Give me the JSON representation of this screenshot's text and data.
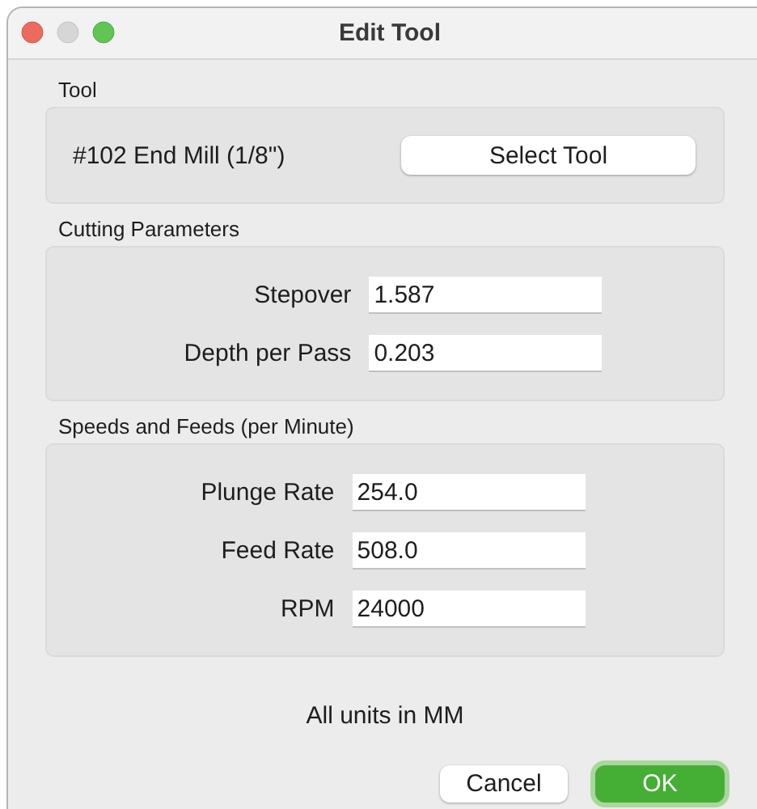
{
  "window": {
    "title": "Edit Tool"
  },
  "sections": [
    {
      "title": "Tool",
      "kind": "tool",
      "tool_name": "#102 End Mill (1/8\")",
      "button": "Select Tool"
    },
    {
      "title": "Cutting Parameters",
      "kind": "fields",
      "fields": [
        {
          "label": "Stepover",
          "value": "1.587"
        },
        {
          "label": "Depth per Pass",
          "value": "0.203"
        }
      ]
    },
    {
      "title": "Speeds and Feeds (per Minute)",
      "kind": "fields",
      "fields": [
        {
          "label": "Plunge Rate",
          "value": "254.0"
        },
        {
          "label": "Feed Rate",
          "value": "508.0"
        },
        {
          "label": "RPM",
          "value": "24000"
        }
      ]
    }
  ],
  "note": "All units in MM",
  "buttons": [
    {
      "label": "Cancel",
      "default": false
    },
    {
      "label": "OK",
      "default": true
    }
  ]
}
